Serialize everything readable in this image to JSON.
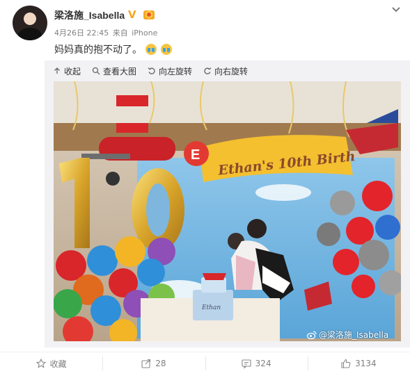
{
  "post": {
    "username": "梁洛施_Isabella",
    "verified_badge": "V",
    "timestamp": "4月26日 22:45",
    "source_prefix": "来自",
    "source": "iPhone",
    "text": "妈妈真的抱不动了。"
  },
  "toolbar": {
    "collapse": "收起",
    "view_large": "查看大图",
    "rotate_left": "向左旋转",
    "rotate_right": "向右旋转"
  },
  "photo": {
    "banner_text": "Ethan's 10th Birth",
    "plane_letter": "E",
    "cake_text": "Ethan",
    "number_one": "1",
    "number_zero": "0",
    "watermark": "@梁洛施_Isabella"
  },
  "actions": {
    "favorite": "收藏",
    "repost_count": "28",
    "comment_count": "324",
    "like_count": "3134"
  },
  "colors": {
    "link": "#eb7350",
    "badge": "#f6a623",
    "text": "#333333",
    "meta": "#808080"
  }
}
